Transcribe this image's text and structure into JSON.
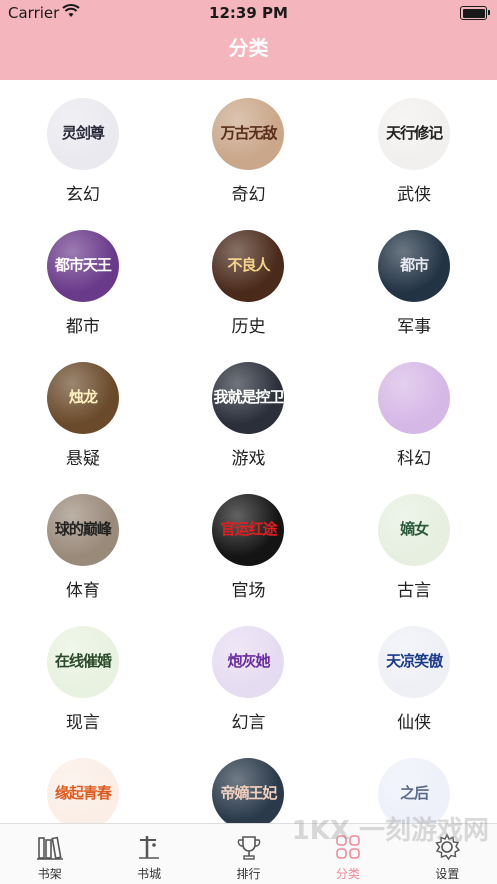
{
  "status": {
    "carrier": "Carrier",
    "time": "12:39 PM"
  },
  "header": {
    "title": "分类"
  },
  "categories": [
    {
      "label": "玄幻",
      "cover_text": "灵剑尊"
    },
    {
      "label": "奇幻",
      "cover_text": "万古无敌"
    },
    {
      "label": "武侠",
      "cover_text": "天行修记"
    },
    {
      "label": "都市",
      "cover_text": "都市天王"
    },
    {
      "label": "历史",
      "cover_text": "不良人"
    },
    {
      "label": "军事",
      "cover_text": "都市"
    },
    {
      "label": "悬疑",
      "cover_text": "烛龙"
    },
    {
      "label": "游戏",
      "cover_text": "我就是控卫"
    },
    {
      "label": "科幻",
      "cover_text": ""
    },
    {
      "label": "体育",
      "cover_text": "球的巅峰"
    },
    {
      "label": "官场",
      "cover_text": "官运红途"
    },
    {
      "label": "古言",
      "cover_text": "嫡女"
    },
    {
      "label": "现言",
      "cover_text": "在线催婚"
    },
    {
      "label": "幻言",
      "cover_text": "炮灰她"
    },
    {
      "label": "仙侠",
      "cover_text": "天凉笑傲"
    },
    {
      "label": "",
      "cover_text": "缘起青春"
    },
    {
      "label": "",
      "cover_text": "帝嫡王妃"
    },
    {
      "label": "",
      "cover_text": "之后"
    }
  ],
  "tabs": [
    {
      "label": "书架",
      "icon": "bookshelf-icon",
      "active": false
    },
    {
      "label": "书城",
      "icon": "bookstore-icon",
      "active": false
    },
    {
      "label": "排行",
      "icon": "trophy-icon",
      "active": false
    },
    {
      "label": "分类",
      "icon": "category-grid-icon",
      "active": true
    },
    {
      "label": "设置",
      "icon": "settings-gear-icon",
      "active": false
    }
  ],
  "watermark": "1KX 一刻游戏网",
  "colors": {
    "header_bg": "#f5b5bd",
    "active_tab": "#f08a9a"
  }
}
